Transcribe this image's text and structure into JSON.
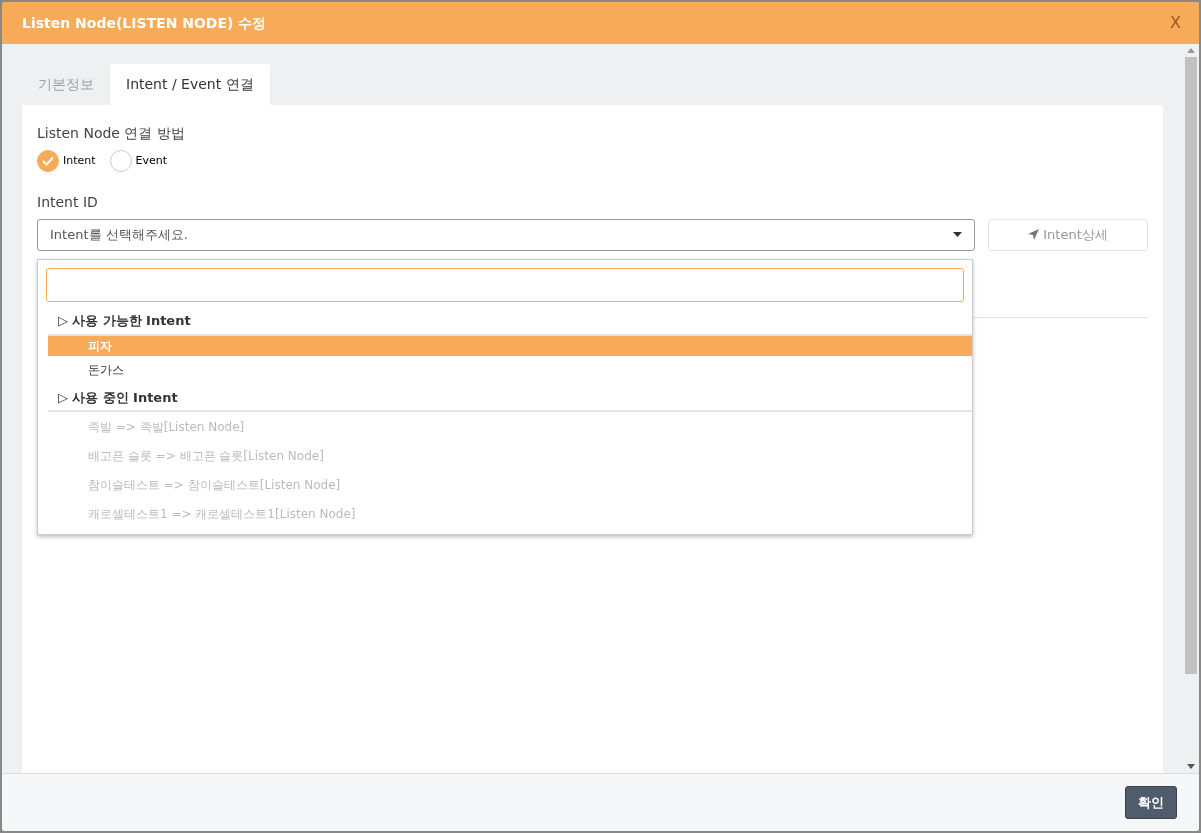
{
  "window": {
    "title": "Listen Node(LISTEN NODE) 수정",
    "close": "X"
  },
  "tabs": [
    {
      "label": "기본정보",
      "selected": false
    },
    {
      "label": "Intent / Event 연결",
      "selected": true
    }
  ],
  "connection": {
    "label": "Listen Node 연결 방법",
    "options": [
      {
        "label": "Intent",
        "selected": true
      },
      {
        "label": "Event",
        "selected": false
      }
    ]
  },
  "intent_id": {
    "label": "Intent ID",
    "placeholder": "Intent를 선택해주세요.",
    "expanded": true,
    "detail_button": {
      "label": "Intent상세",
      "disabled": true
    }
  },
  "dropdown": {
    "groups": [
      {
        "marker": "▷",
        "label": "사용 가능한 Intent",
        "items": [
          {
            "text": "피자",
            "selected": true,
            "disabled": false
          },
          {
            "text": "돈가스",
            "selected": false,
            "disabled": false
          }
        ]
      },
      {
        "marker": "▷",
        "label": "사용 중인 Intent",
        "items": [
          {
            "text": "족발 => 족발[Listen Node]",
            "selected": false,
            "disabled": true
          },
          {
            "text": "배고픈 슬롯 => 배고픈 슬롯[Listen Node]",
            "selected": false,
            "disabled": true
          },
          {
            "text": "참이슬테스트 => 참이슬테스트[Listen Node]",
            "selected": false,
            "disabled": true
          },
          {
            "text": "캐로셀테스트1 => 캐로셀테스트1[Listen Node]",
            "selected": false,
            "disabled": true
          }
        ]
      }
    ]
  },
  "footer": {
    "confirm": "확인"
  }
}
